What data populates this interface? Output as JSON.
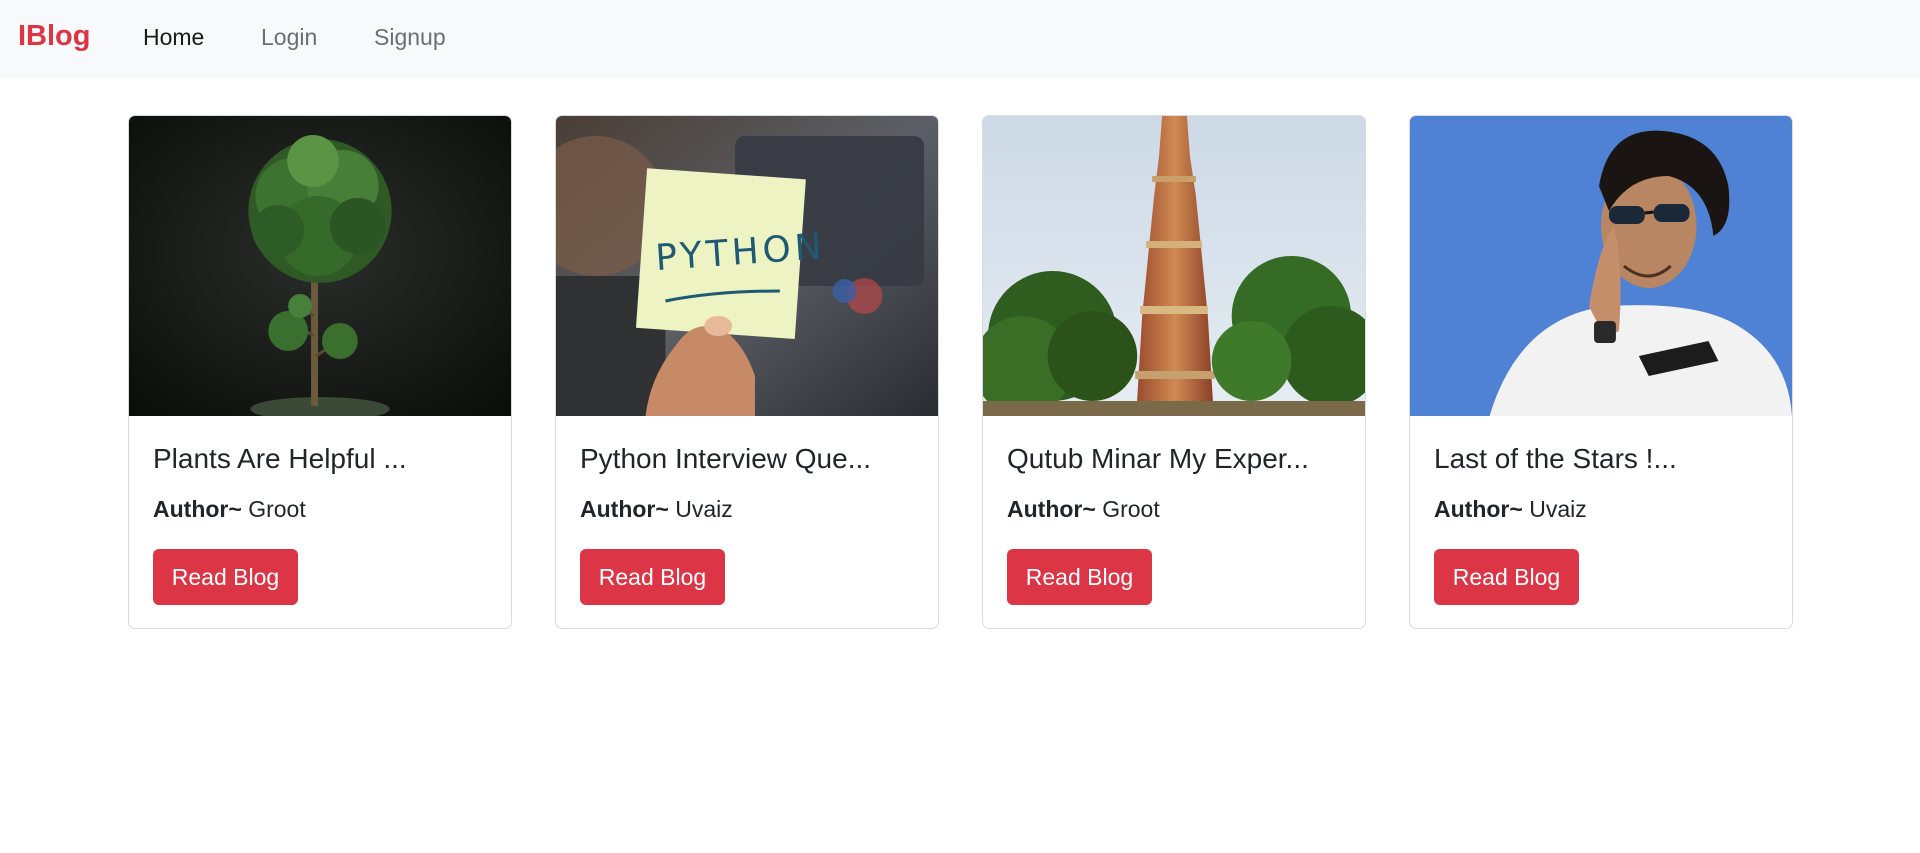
{
  "nav": {
    "brand": "IBlog",
    "links": [
      "Home",
      "Login",
      "Signup"
    ],
    "active": "Home",
    "brand_color": "#dc3545"
  },
  "cards": [
    {
      "title": "Plants Are Helpful ...",
      "author_label": "Author~",
      "author": "Groot",
      "button_label": "Read Blog",
      "image": "potted-plant-photo"
    },
    {
      "title": "Python Interview Que...",
      "author_label": "Author~",
      "author": "Uvaiz",
      "button_label": "Read Blog",
      "image": "python-sticky-note-photo",
      "image_text": "PYTHON"
    },
    {
      "title": "Qutub Minar My Exper...",
      "author_label": "Author~",
      "author": "Groot",
      "button_label": "Read Blog",
      "image": "qutub-minar-photo"
    },
    {
      "title": "Last of the Stars !...",
      "author_label": "Author~",
      "author": "Uvaiz",
      "button_label": "Read Blog",
      "image": "man-greeting-photo"
    }
  ],
  "colors": {
    "button": "#dc3545",
    "navbar_bg": "#f8f9fa"
  }
}
